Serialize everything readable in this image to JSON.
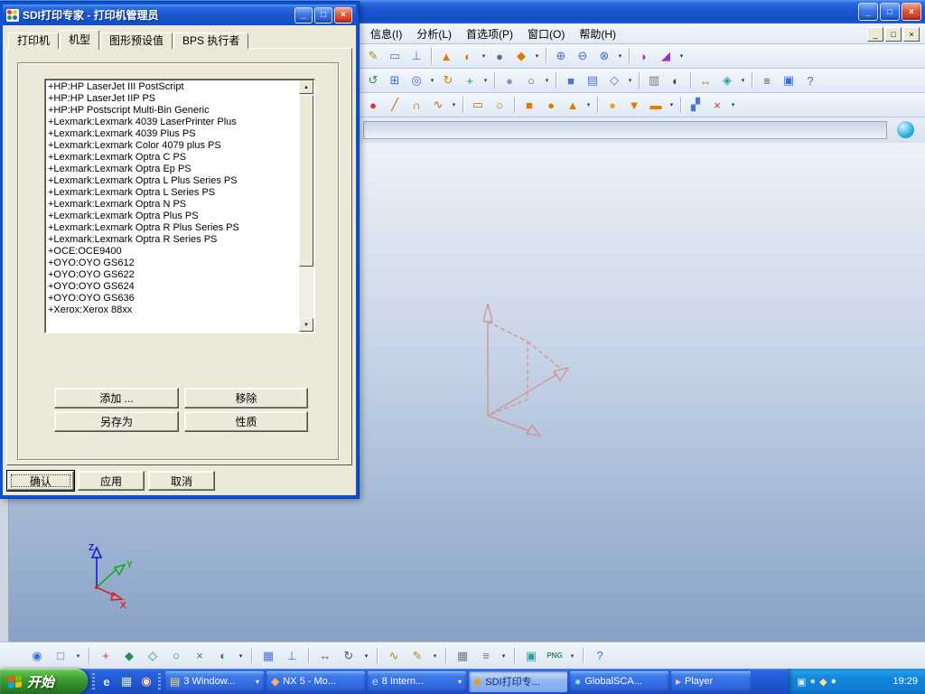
{
  "colors": {
    "dialog_bg": "#ece9d8",
    "titlebar_top": "#5a9af5",
    "titlebar_bottom": "#0f4fc8",
    "canvas_top": "#edf2f9",
    "canvas_bottom": "#87a1c6",
    "sketch_line": "#d49090",
    "taskbar_blue": "#2157d2",
    "tray_blue": "#1487dd",
    "start_green": "#2e862a",
    "axis_x": "#dd2020",
    "axis_y": "#18a818",
    "axis_z": "#1818e0",
    "win_flag_red": "#f35325",
    "win_flag_green": "#81bc06",
    "win_flag_blue": "#05a6f0",
    "win_flag_yellow": "#ffba08"
  },
  "window_buttons": [
    {
      "name": "minimize",
      "glyph": "_"
    },
    {
      "name": "maximize",
      "glyph": "□"
    },
    {
      "name": "close",
      "glyph": "×"
    }
  ],
  "dialog": {
    "title": "SDI打印专家 - 打印机管理员",
    "tabs": [
      "打印机",
      "机型",
      "图形预设值",
      "BPS 执行者"
    ],
    "active_tab_index": 1,
    "printers": [
      "+HP:HP LaserJet III PostScript",
      "+HP:HP LaserJet IIP PS",
      "+HP:HP Postscript Multi-Bin Generic",
      "+Lexmark:Lexmark 4039 LaserPrinter Plus",
      "+Lexmark:Lexmark 4039 Plus PS",
      "+Lexmark:Lexmark Color 4079 plus PS",
      "+Lexmark:Lexmark Optra C PS",
      "+Lexmark:Lexmark Optra Ep PS",
      "+Lexmark:Lexmark Optra L Plus Series PS",
      "+Lexmark:Lexmark Optra L Series PS",
      "+Lexmark:Lexmark Optra N PS",
      "+Lexmark:Lexmark Optra Plus PS",
      "+Lexmark:Lexmark Optra R Plus Series PS",
      "+Lexmark:Lexmark Optra R Series PS",
      "+OCE:OCE9400",
      "+OYO:OYO GS612",
      "+OYO:OYO GS622",
      "+OYO:OYO GS624",
      "+OYO:OYO GS636",
      "+Xerox:Xerox 88xx"
    ],
    "buttons": {
      "add": "添加 ...",
      "remove": "移除",
      "save_as": "另存为",
      "properties": "性质",
      "ok": "确认",
      "apply": "应用",
      "cancel": "取消"
    },
    "scrollbar": {
      "up": "▲",
      "down": "▼"
    }
  },
  "app": {
    "menus": [
      "信息(I)",
      "分析(L)",
      "首选项(P)",
      "窗口(O)",
      "帮助(H)"
    ],
    "toolbars": {
      "row1": [
        {
          "name": "sketch-icon",
          "glyph": "✎",
          "color": "#b8860b"
        },
        {
          "name": "datum-plane-icon",
          "glyph": "▭",
          "color": "#4a77d4"
        },
        {
          "name": "datum-csys-icon",
          "glyph": "⊥",
          "color": "#4a77d4"
        },
        {
          "sep": true
        },
        {
          "name": "extrude-icon",
          "glyph": "▲",
          "color": "#e07b00"
        },
        {
          "name": "revolve-icon",
          "glyph": "◐",
          "color": "#e07b00"
        },
        {
          "drop": true
        },
        {
          "name": "hole-icon",
          "glyph": "●",
          "color": "#607080"
        },
        {
          "name": "boss-icon",
          "glyph": "◆",
          "color": "#e07b00"
        },
        {
          "drop": true
        },
        {
          "sep": true
        },
        {
          "name": "unite-icon",
          "glyph": "⊕",
          "color": "#3a6fd8"
        },
        {
          "name": "subtract-icon",
          "glyph": "⊖",
          "color": "#3a6fd8"
        },
        {
          "name": "intersect-icon",
          "glyph": "⊗",
          "color": "#3a6fd8"
        },
        {
          "drop": true
        },
        {
          "sep": true
        },
        {
          "name": "edge-blend-icon",
          "glyph": "◗",
          "color": "#9932cc"
        },
        {
          "name": "chamfer-icon",
          "glyph": "◢",
          "color": "#9932cc"
        },
        {
          "drop": true
        }
      ],
      "row2": [
        {
          "name": "refresh-icon",
          "glyph": "↺",
          "color": "#2e8b57"
        },
        {
          "name": "fit-view-icon",
          "glyph": "⊞",
          "color": "#3a6fd8"
        },
        {
          "name": "zoom-icon",
          "glyph": "◎",
          "color": "#3a6fd8"
        },
        {
          "drop": true
        },
        {
          "name": "rotate-view-icon",
          "glyph": "↻",
          "color": "#e07b00"
        },
        {
          "name": "pan-icon",
          "glyph": "+",
          "color": "#2e8b57"
        },
        {
          "drop": true
        },
        {
          "sep": true
        },
        {
          "name": "shaded-view-icon",
          "glyph": "●",
          "color": "#8a98b8"
        },
        {
          "name": "wireframe-view-icon",
          "glyph": "○",
          "color": "#55637a"
        },
        {
          "drop": true
        },
        {
          "sep": true
        },
        {
          "name": "front-view-icon",
          "glyph": "■",
          "color": "#4a77d4"
        },
        {
          "name": "top-view-icon",
          "glyph": "▤",
          "color": "#4a77d4"
        },
        {
          "name": "isometric-view-icon",
          "glyph": "◇",
          "color": "#4a77d4"
        },
        {
          "drop": true
        },
        {
          "sep": true
        },
        {
          "name": "layer-settings-icon",
          "glyph": "▥",
          "color": "#777777"
        },
        {
          "name": "show-hide-icon",
          "glyph": "◐",
          "color": "#444444"
        },
        {
          "sep": true
        },
        {
          "name": "measure-icon",
          "glyph": "↔",
          "color": "#b8860b"
        },
        {
          "name": "analysis-icon",
          "glyph": "◈",
          "color": "#2aa0a0"
        },
        {
          "drop": true
        },
        {
          "sep": true
        },
        {
          "name": "preferences-icon",
          "glyph": "≡",
          "color": "#555555"
        },
        {
          "name": "window-icon",
          "glyph": "▣",
          "color": "#3a6fd8"
        },
        {
          "name": "help-icon",
          "glyph": "?",
          "color": "#3a6fd8"
        }
      ],
      "row3": [
        {
          "name": "point-icon",
          "glyph": "●",
          "color": "#cc3333"
        },
        {
          "name": "line-icon",
          "glyph": "╱",
          "color": "#cc6600"
        },
        {
          "name": "arc-icon",
          "glyph": "∩",
          "color": "#cc6600"
        },
        {
          "name": "spline-icon",
          "glyph": "∿",
          "color": "#cc6600"
        },
        {
          "drop": true
        },
        {
          "sep": true
        },
        {
          "name": "rectangle-icon",
          "glyph": "▭",
          "color": "#cc6600"
        },
        {
          "name": "circle-icon",
          "glyph": "○",
          "color": "#cc6600"
        },
        {
          "sep": true
        },
        {
          "name": "block-icon",
          "glyph": "■",
          "color": "#e07b00"
        },
        {
          "name": "cylinder-icon",
          "glyph": "●",
          "color": "#e07b00"
        },
        {
          "name": "cone-icon",
          "glyph": "▲",
          "color": "#e07b00"
        },
        {
          "drop": true
        },
        {
          "sep": true
        },
        {
          "name": "sphere-icon",
          "glyph": "●",
          "color": "#f0a030"
        },
        {
          "name": "pocket-icon",
          "glyph": "▼",
          "color": "#e07b00"
        },
        {
          "name": "pad-icon",
          "glyph": "▬",
          "color": "#e07b00"
        },
        {
          "drop": true
        },
        {
          "sep": true
        },
        {
          "name": "mirror-feature-icon",
          "glyph": "▞",
          "color": "#4a77d4"
        },
        {
          "name": "trim-body-icon",
          "glyph": "×",
          "color": "#cc3333"
        },
        {
          "drop": true
        }
      ],
      "bottom": [
        {
          "name": "selection-filter-icon",
          "glyph": "◉",
          "color": "#3a6fd8"
        },
        {
          "name": "selection-scope-icon",
          "glyph": "□",
          "color": "#3a6fd8"
        },
        {
          "drop": true
        },
        {
          "sep": true
        },
        {
          "name": "snap-point-icon",
          "glyph": "+",
          "color": "#cc3333"
        },
        {
          "name": "end-point-icon",
          "glyph": "◆",
          "color": "#2e8b57"
        },
        {
          "name": "mid-point-icon",
          "glyph": "◇",
          "color": "#2e8b57"
        },
        {
          "name": "center-point-icon",
          "glyph": "○",
          "color": "#2e8b57"
        },
        {
          "name": "intersection-point-icon",
          "glyph": "×",
          "color": "#2e8b57"
        },
        {
          "name": "quadrant-point-icon",
          "glyph": "◐",
          "color": "#2e8b57"
        },
        {
          "drop": true
        },
        {
          "sep": true
        },
        {
          "name": "work-plane-icon",
          "glyph": "▦",
          "color": "#4a77d4"
        },
        {
          "name": "plane-normal-icon",
          "glyph": "⊥",
          "color": "#4a77d4"
        },
        {
          "sep": true
        },
        {
          "name": "move-object-icon",
          "glyph": "↔",
          "color": "#555566"
        },
        {
          "name": "rotate-object-icon",
          "glyph": "↻",
          "color": "#555566"
        },
        {
          "drop": true
        },
        {
          "sep": true
        },
        {
          "name": "curve-tool-icon",
          "glyph": "∿",
          "color": "#b8860b"
        },
        {
          "name": "edit-curve-icon",
          "glyph": "✎",
          "color": "#b8860b"
        },
        {
          "drop": true
        },
        {
          "sep": true
        },
        {
          "name": "grid-icon",
          "glyph": "▦",
          "color": "#777788"
        },
        {
          "name": "list-view-icon",
          "glyph": "≡",
          "color": "#777788"
        },
        {
          "drop": true
        },
        {
          "sep": true
        },
        {
          "name": "capture-image-icon",
          "glyph": "▣",
          "color": "#2aa0a0"
        },
        {
          "name": "png-export-icon",
          "text": "PNG",
          "color": "#2e8b57"
        },
        {
          "drop": true
        },
        {
          "sep": true
        },
        {
          "name": "context-help-icon",
          "glyph": "?",
          "color": "#3a6fd8"
        }
      ]
    }
  },
  "canvas": {
    "triad": {
      "x_label": "X",
      "y_label": "Y",
      "z_label": "Z"
    }
  },
  "taskbar": {
    "start_label": "开始",
    "quick_launch": [
      {
        "name": "quick-launch-internet-explorer-icon",
        "glyph": "e",
        "color": "#d8ecff"
      },
      {
        "name": "quick-launch-show-desktop-icon",
        "glyph": "▦",
        "color": "#cfe6c8"
      },
      {
        "name": "quick-launch-media-player-icon",
        "glyph": "◉",
        "color": "#ffd8a8"
      }
    ],
    "tasks": [
      {
        "name": "task-windows-explorer-group",
        "label": "3 Window...",
        "glyph": "▤",
        "color": "#ffd86a",
        "grouped": true,
        "active": false
      },
      {
        "name": "task-nx5",
        "label": "NX 5 - Mo...",
        "glyph": "◆",
        "color": "#ffb066",
        "grouped": false,
        "active": false
      },
      {
        "name": "task-internet-explorer-group",
        "label": "8 Intern...",
        "glyph": "e",
        "color": "#bfe0ff",
        "grouped": true,
        "active": false
      },
      {
        "name": "task-sdi-print-expert",
        "label": "SDI打印专...",
        "glyph": "◆",
        "color": "#e0a020",
        "grouped": false,
        "active": true
      },
      {
        "name": "task-globalscan",
        "label": "GlobalSCA...",
        "glyph": "●",
        "color": "#8ae0e0",
        "grouped": false,
        "active": false
      },
      {
        "name": "task-player",
        "label": "Player",
        "glyph": "▸",
        "color": "#e0c8ff",
        "grouped": false,
        "active": false
      }
    ],
    "tray_icons": [
      {
        "name": "tray-icon-1",
        "glyph": "▣",
        "color": "#d8ecff"
      },
      {
        "name": "tray-icon-2",
        "glyph": "●",
        "color": "#9ef09e"
      },
      {
        "name": "tray-icon-3",
        "glyph": "◆",
        "color": "#ffe08a"
      },
      {
        "name": "tray-icon-4",
        "glyph": "●",
        "color": "#cfe6ff"
      }
    ],
    "clock": "19:29"
  }
}
